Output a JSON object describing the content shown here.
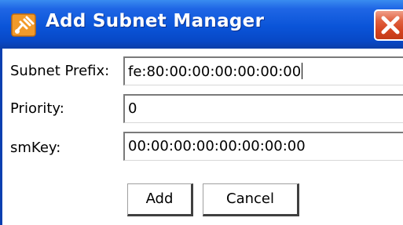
{
  "window": {
    "title": "Add Subnet Manager"
  },
  "icons": {
    "app": "network-plug-icon",
    "close": "close-icon"
  },
  "colors": {
    "titlebar": "#0a54d8",
    "close_button": "#d4431f",
    "content_background": "#ffffff"
  },
  "form": {
    "subnet_prefix": {
      "label": "Subnet Prefix:",
      "value": "fe:80:00:00:00:00:00:00"
    },
    "priority": {
      "label": "Priority:",
      "value": "0"
    },
    "sm_key": {
      "label": "smKey:",
      "value": "00:00:00:00:00:00:00:00"
    }
  },
  "buttons": {
    "add_label": "Add",
    "cancel_label": "Cancel"
  }
}
